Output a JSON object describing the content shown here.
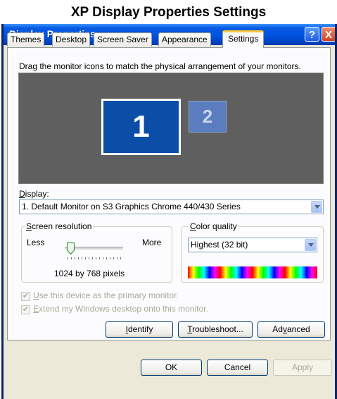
{
  "caption": "XP Display Properties Settings",
  "window": {
    "title": "Display Properties",
    "help_glyph": "?",
    "close_glyph": "X"
  },
  "tabs": [
    "Themes",
    "Desktop",
    "Screen Saver",
    "Appearance",
    "Settings"
  ],
  "active_tab": "Settings",
  "instructions": "Drag the monitor icons to match the physical arrangement of your monitors.",
  "monitors": [
    {
      "number": "1",
      "selected": true
    },
    {
      "number": "2",
      "selected": false
    }
  ],
  "display": {
    "label_underlined": "D",
    "label_rest": "isplay:",
    "value": "1. Default Monitor on S3 Graphics Chrome 440/430 Series"
  },
  "resolution": {
    "title_underlined": "S",
    "title_rest": "creen resolution",
    "less": "Less",
    "more": "More",
    "value": "1024 by 768 pixels",
    "slider_level": 0.1
  },
  "color_quality": {
    "title_underlined": "C",
    "title_rest": "olor quality",
    "value": "Highest (32 bit)"
  },
  "checkboxes": [
    {
      "underlined": "U",
      "rest": "se this device as the primary monitor.",
      "checked": true,
      "enabled": false
    },
    {
      "underlined": "E",
      "rest": "xtend my Windows desktop onto this monitor.",
      "checked": true,
      "enabled": false
    }
  ],
  "buttons": {
    "identify_u": "I",
    "identify_rest": "dentify",
    "troubleshoot_u": "T",
    "troubleshoot_rest": "roubleshoot...",
    "advanced_pre": "Ad",
    "advanced_u": "v",
    "advanced_rest": "anced",
    "ok": "OK",
    "cancel": "Cancel",
    "apply": "Apply"
  },
  "colors": {
    "title_blue": "#0054e3",
    "dialog_bg": "#ece9d8",
    "monitor_bg": "#5f5f5f",
    "monitor_selected": "#0a4ea8"
  }
}
